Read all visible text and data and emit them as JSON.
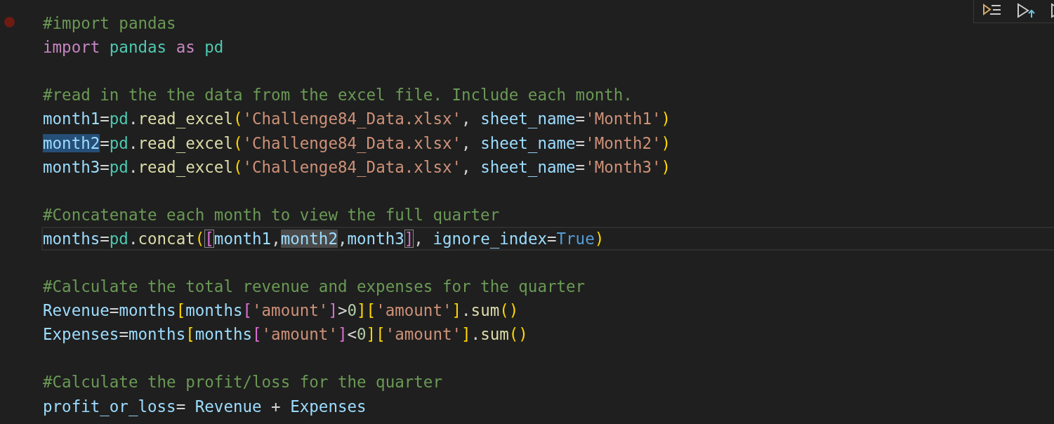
{
  "toolbar": {
    "buttons": [
      {
        "kind": "run-by-line"
      },
      {
        "kind": "run-above"
      },
      {
        "kind": "run"
      }
    ]
  },
  "lines": [
    {
      "breakpoint": true,
      "current": false,
      "tokens": [
        {
          "text": "#import pandas",
          "kind": "comment"
        }
      ]
    },
    {
      "breakpoint": false,
      "current": false,
      "tokens": [
        {
          "text": "import",
          "kind": "keyword"
        },
        {
          "text": " pandas",
          "kind": "module"
        },
        {
          "text": " as",
          "kind": "keyword"
        },
        {
          "text": " pd",
          "kind": "module"
        }
      ]
    },
    {
      "breakpoint": false,
      "current": false
    },
    {
      "breakpoint": false,
      "current": false,
      "tokens": [
        {
          "text": "#read in the the data from the excel file. Include each month.",
          "kind": "comment"
        }
      ]
    },
    {
      "breakpoint": false,
      "current": false,
      "tokens": [
        {
          "text": "month1",
          "kind": "variable"
        },
        {
          "text": "=",
          "kind": "plain"
        },
        {
          "text": "pd",
          "kind": "module"
        },
        {
          "text": ".",
          "kind": "plain"
        },
        {
          "text": "read_excel",
          "kind": "function"
        },
        {
          "text": "(",
          "kind": "bracket1"
        },
        {
          "text": "'Challenge84_Data.xlsx'",
          "kind": "string"
        },
        {
          "text": ", ",
          "kind": "plain"
        },
        {
          "text": "sheet_name",
          "kind": "variable"
        },
        {
          "text": "=",
          "kind": "plain"
        },
        {
          "text": "'Month1'",
          "kind": "string"
        },
        {
          "text": ")",
          "kind": "bracket1"
        }
      ]
    },
    {
      "breakpoint": false,
      "current": false,
      "tokens": [
        {
          "text": "month2",
          "kind": "variable",
          "selected": true
        },
        {
          "text": "=",
          "kind": "plain"
        },
        {
          "text": "pd",
          "kind": "module"
        },
        {
          "text": ".",
          "kind": "plain"
        },
        {
          "text": "read_excel",
          "kind": "function"
        },
        {
          "text": "(",
          "kind": "bracket1"
        },
        {
          "text": "'Challenge84_Data.xlsx'",
          "kind": "string"
        },
        {
          "text": ", ",
          "kind": "plain"
        },
        {
          "text": "sheet_name",
          "kind": "variable"
        },
        {
          "text": "=",
          "kind": "plain"
        },
        {
          "text": "'Month2'",
          "kind": "string"
        },
        {
          "text": ")",
          "kind": "bracket1"
        }
      ]
    },
    {
      "breakpoint": false,
      "current": false,
      "tokens": [
        {
          "text": "month3",
          "kind": "variable"
        },
        {
          "text": "=",
          "kind": "plain"
        },
        {
          "text": "pd",
          "kind": "module"
        },
        {
          "text": ".",
          "kind": "plain"
        },
        {
          "text": "read_excel",
          "kind": "function"
        },
        {
          "text": "(",
          "kind": "bracket1"
        },
        {
          "text": "'Challenge84_Data.xlsx'",
          "kind": "string"
        },
        {
          "text": ", ",
          "kind": "plain"
        },
        {
          "text": "sheet_name",
          "kind": "variable"
        },
        {
          "text": "=",
          "kind": "plain"
        },
        {
          "text": "'Month3'",
          "kind": "string"
        },
        {
          "text": ")",
          "kind": "bracket1"
        }
      ]
    },
    {
      "breakpoint": false,
      "current": false
    },
    {
      "breakpoint": false,
      "current": false,
      "tokens": [
        {
          "text": "#Concatenate each month to view the full quarter",
          "kind": "comment"
        }
      ]
    },
    {
      "breakpoint": false,
      "current": true,
      "tokens": [
        {
          "text": "months",
          "kind": "variable"
        },
        {
          "text": "=",
          "kind": "plain"
        },
        {
          "text": "pd",
          "kind": "module"
        },
        {
          "text": ".",
          "kind": "plain"
        },
        {
          "text": "concat",
          "kind": "function"
        },
        {
          "text": "(",
          "kind": "bracket1"
        },
        {
          "text": "[",
          "kind": "bracket2",
          "bracket_match": true
        },
        {
          "text": "month1",
          "kind": "variable"
        },
        {
          "text": ",",
          "kind": "plain"
        },
        {
          "text": "month2",
          "kind": "variable",
          "occurrence": true
        },
        {
          "text": ",",
          "kind": "plain"
        },
        {
          "text": "month3",
          "kind": "variable"
        },
        {
          "text": "]",
          "kind": "bracket2",
          "bracket_match": true
        },
        {
          "text": ", ",
          "kind": "plain"
        },
        {
          "text": "ignore_index",
          "kind": "variable"
        },
        {
          "text": "=",
          "kind": "plain"
        },
        {
          "text": "True",
          "kind": "constant"
        },
        {
          "text": ")",
          "kind": "bracket1"
        }
      ]
    },
    {
      "breakpoint": false,
      "current": false
    },
    {
      "breakpoint": false,
      "current": false,
      "tokens": [
        {
          "text": "#Calculate the total revenue and expenses for the quarter",
          "kind": "comment"
        }
      ]
    },
    {
      "breakpoint": false,
      "current": false,
      "tokens": [
        {
          "text": "Revenue",
          "kind": "variable"
        },
        {
          "text": "=",
          "kind": "plain"
        },
        {
          "text": "months",
          "kind": "variable"
        },
        {
          "text": "[",
          "kind": "bracket1"
        },
        {
          "text": "months",
          "kind": "variable"
        },
        {
          "text": "[",
          "kind": "bracket2"
        },
        {
          "text": "'amount'",
          "kind": "string"
        },
        {
          "text": "]",
          "kind": "bracket2"
        },
        {
          "text": ">",
          "kind": "plain"
        },
        {
          "text": "0",
          "kind": "number"
        },
        {
          "text": "]",
          "kind": "bracket1"
        },
        {
          "text": "[",
          "kind": "bracket1"
        },
        {
          "text": "'amount'",
          "kind": "string"
        },
        {
          "text": "]",
          "kind": "bracket1"
        },
        {
          "text": ".",
          "kind": "plain"
        },
        {
          "text": "sum",
          "kind": "function"
        },
        {
          "text": "()",
          "kind": "bracket1"
        }
      ]
    },
    {
      "breakpoint": false,
      "current": false,
      "tokens": [
        {
          "text": "Expenses",
          "kind": "variable"
        },
        {
          "text": "=",
          "kind": "plain"
        },
        {
          "text": "months",
          "kind": "variable"
        },
        {
          "text": "[",
          "kind": "bracket1"
        },
        {
          "text": "months",
          "kind": "variable"
        },
        {
          "text": "[",
          "kind": "bracket2"
        },
        {
          "text": "'amount'",
          "kind": "string"
        },
        {
          "text": "]",
          "kind": "bracket2"
        },
        {
          "text": "<",
          "kind": "plain"
        },
        {
          "text": "0",
          "kind": "number"
        },
        {
          "text": "]",
          "kind": "bracket1"
        },
        {
          "text": "[",
          "kind": "bracket1"
        },
        {
          "text": "'amount'",
          "kind": "string"
        },
        {
          "text": "]",
          "kind": "bracket1"
        },
        {
          "text": ".",
          "kind": "plain"
        },
        {
          "text": "sum",
          "kind": "function"
        },
        {
          "text": "()",
          "kind": "bracket1"
        }
      ]
    },
    {
      "breakpoint": false,
      "current": false
    },
    {
      "breakpoint": false,
      "current": false,
      "tokens": [
        {
          "text": "#Calculate the profit/loss for the quarter",
          "kind": "comment"
        }
      ]
    },
    {
      "breakpoint": false,
      "current": false,
      "tokens": [
        {
          "text": "profit_or_loss",
          "kind": "variable"
        },
        {
          "text": "= ",
          "kind": "plain"
        },
        {
          "text": "Revenue",
          "kind": "variable"
        },
        {
          "text": " + ",
          "kind": "plain"
        },
        {
          "text": "Expenses",
          "kind": "variable"
        }
      ]
    }
  ]
}
